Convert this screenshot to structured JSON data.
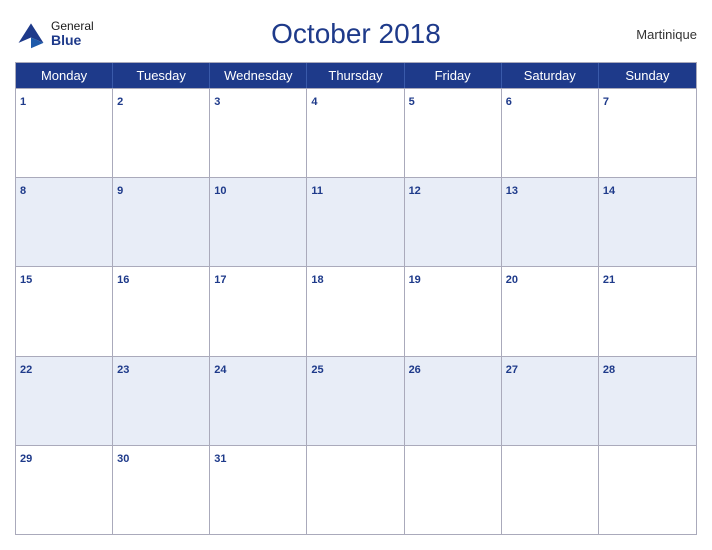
{
  "header": {
    "title": "October 2018",
    "region": "Martinique",
    "logo_general": "General",
    "logo_blue": "Blue"
  },
  "days_of_week": [
    "Monday",
    "Tuesday",
    "Wednesday",
    "Thursday",
    "Friday",
    "Saturday",
    "Sunday"
  ],
  "weeks": [
    [
      {
        "date": "1",
        "empty": false
      },
      {
        "date": "2",
        "empty": false
      },
      {
        "date": "3",
        "empty": false
      },
      {
        "date": "4",
        "empty": false
      },
      {
        "date": "5",
        "empty": false
      },
      {
        "date": "6",
        "empty": false
      },
      {
        "date": "7",
        "empty": false
      }
    ],
    [
      {
        "date": "8",
        "empty": false
      },
      {
        "date": "9",
        "empty": false
      },
      {
        "date": "10",
        "empty": false
      },
      {
        "date": "11",
        "empty": false
      },
      {
        "date": "12",
        "empty": false
      },
      {
        "date": "13",
        "empty": false
      },
      {
        "date": "14",
        "empty": false
      }
    ],
    [
      {
        "date": "15",
        "empty": false
      },
      {
        "date": "16",
        "empty": false
      },
      {
        "date": "17",
        "empty": false
      },
      {
        "date": "18",
        "empty": false
      },
      {
        "date": "19",
        "empty": false
      },
      {
        "date": "20",
        "empty": false
      },
      {
        "date": "21",
        "empty": false
      }
    ],
    [
      {
        "date": "22",
        "empty": false
      },
      {
        "date": "23",
        "empty": false
      },
      {
        "date": "24",
        "empty": false
      },
      {
        "date": "25",
        "empty": false
      },
      {
        "date": "26",
        "empty": false
      },
      {
        "date": "27",
        "empty": false
      },
      {
        "date": "28",
        "empty": false
      }
    ],
    [
      {
        "date": "29",
        "empty": false
      },
      {
        "date": "30",
        "empty": false
      },
      {
        "date": "31",
        "empty": false
      },
      {
        "date": "",
        "empty": true
      },
      {
        "date": "",
        "empty": true
      },
      {
        "date": "",
        "empty": true
      },
      {
        "date": "",
        "empty": true
      }
    ]
  ]
}
